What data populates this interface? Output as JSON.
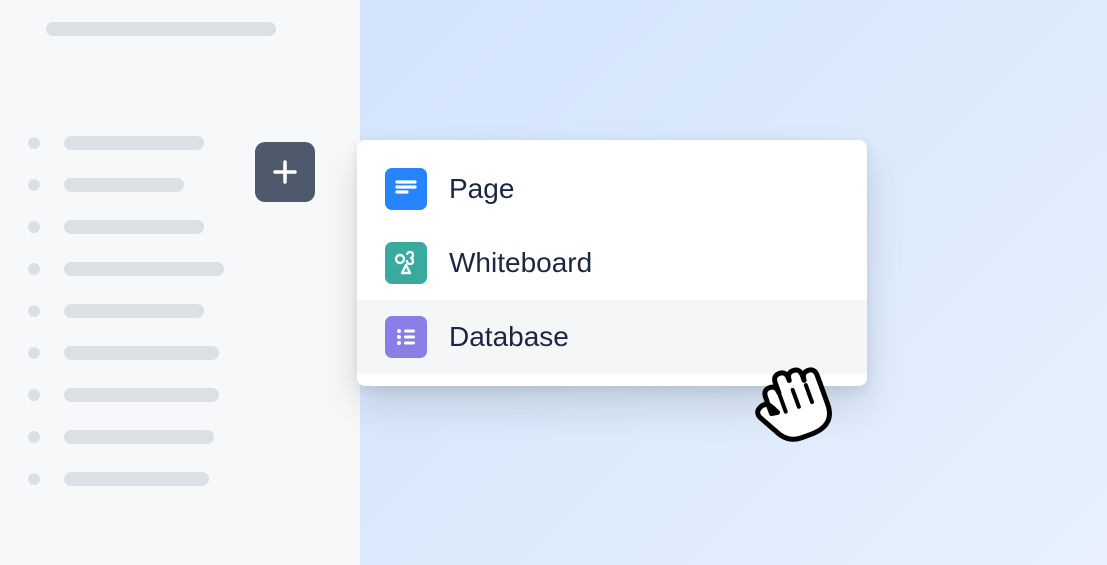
{
  "menu": {
    "items": [
      {
        "label": "Page",
        "icon": "page-icon",
        "color": "#2684ff"
      },
      {
        "label": "Whiteboard",
        "icon": "whiteboard-icon",
        "color": "#3aa99e"
      },
      {
        "label": "Database",
        "icon": "database-icon",
        "color": "#8a7ee6"
      }
    ],
    "hovered_index": 2
  },
  "sidebar": {
    "title_placeholder": "",
    "item_widths": [
      140,
      120,
      140,
      160,
      140,
      155,
      155,
      150,
      145
    ]
  },
  "add_button": {
    "label": "+"
  }
}
